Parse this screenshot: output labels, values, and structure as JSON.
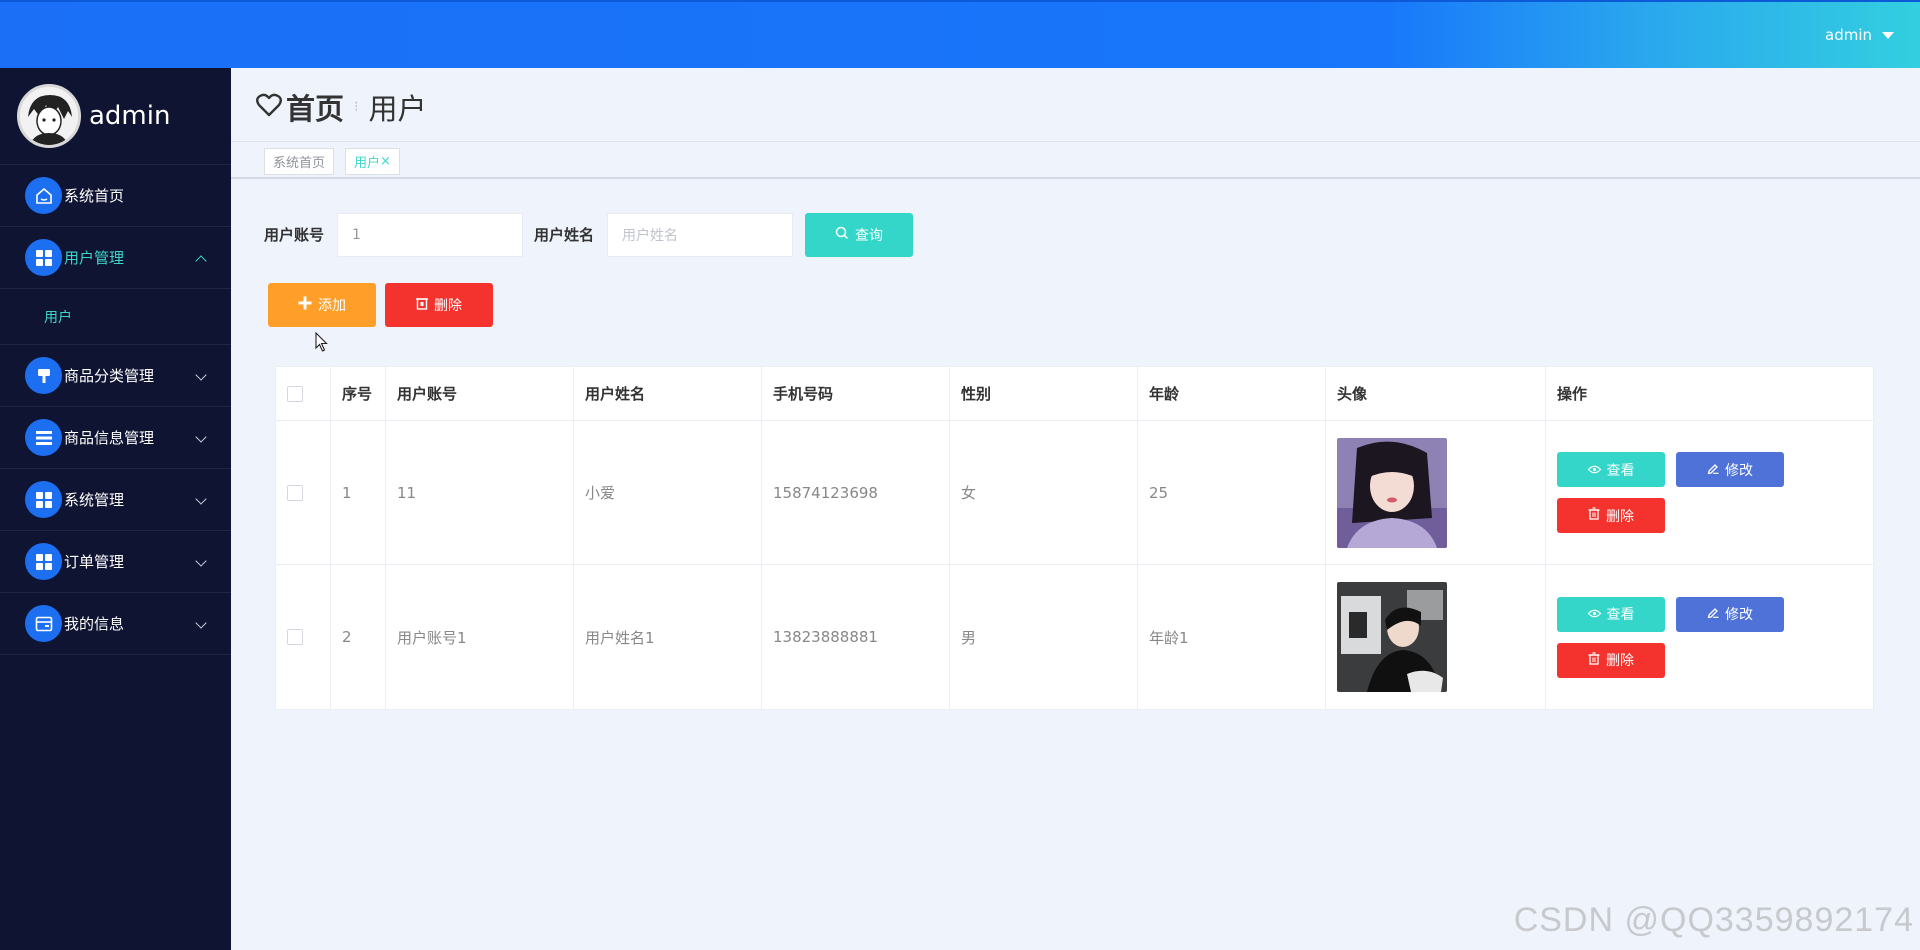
{
  "topbar": {
    "user_label": "admin"
  },
  "sidebar": {
    "profile_name": "admin",
    "items": [
      {
        "label": "系统首页",
        "icon": "home-icon"
      },
      {
        "label": "用户管理",
        "icon": "grid-icon",
        "expanded": true,
        "children": [
          {
            "label": "用户"
          }
        ]
      },
      {
        "label": "商品分类管理",
        "icon": "brush-icon"
      },
      {
        "label": "商品信息管理",
        "icon": "list-icon"
      },
      {
        "label": "系统管理",
        "icon": "grid-icon"
      },
      {
        "label": "订单管理",
        "icon": "grid-icon"
      },
      {
        "label": "我的信息",
        "icon": "card-icon"
      }
    ]
  },
  "header": {
    "home": "首页",
    "current": "用户"
  },
  "tabs": [
    {
      "label": "系统首页"
    },
    {
      "label": "用户",
      "close": "×",
      "active": true
    }
  ],
  "search": {
    "account_label": "用户账号",
    "account_value": "1",
    "name_label": "用户姓名",
    "name_placeholder": "用户姓名",
    "query_button": "查询"
  },
  "actions": {
    "add_button": "添加",
    "delete_button": "删除"
  },
  "table": {
    "columns": [
      "序号",
      "用户账号",
      "用户姓名",
      "手机号码",
      "性别",
      "年龄",
      "头像",
      "操作"
    ],
    "rows": [
      {
        "index": "1",
        "account": "11",
        "name": "小爱",
        "phone": "15874123698",
        "gender": "女",
        "age": "25"
      },
      {
        "index": "2",
        "account": "用户账号1",
        "name": "用户姓名1",
        "phone": "13823888881",
        "gender": "男",
        "age": "年龄1"
      }
    ],
    "view_button": "查看",
    "edit_button": "修改",
    "delete_button": "删除"
  },
  "watermark": "CSDN @QQ3359892174",
  "colors": {
    "primary": "#1877fb",
    "teal": "#33d6c8",
    "orange": "#ff9f2a",
    "red": "#f5332e",
    "blue": "#4f72d8",
    "sidebar": "#0f1433"
  }
}
